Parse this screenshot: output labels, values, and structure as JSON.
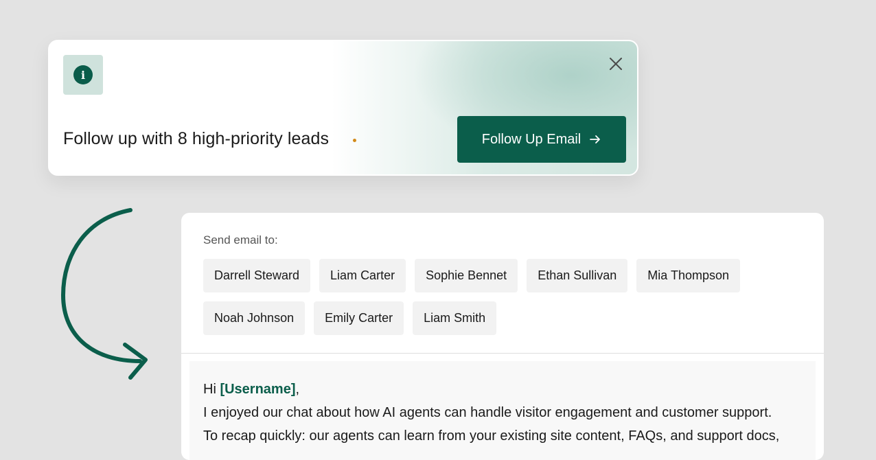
{
  "notification": {
    "message": "Follow up with 8 high-priority leads",
    "button_label": "Follow Up Email",
    "icons": {
      "info": "info-icon",
      "close": "close-icon",
      "button": "arrow-right-icon"
    },
    "info_glyph": "i"
  },
  "email": {
    "send_label": "Send email to:",
    "recipients": [
      "Darrell Steward",
      "Liam Carter",
      "Sophie Bennet",
      "Ethan Sullivan",
      "Mia Thompson",
      "Noah Johnson",
      "Emily Carter",
      "Liam Smith"
    ],
    "greeting_prefix": "Hi ",
    "username_placeholder": "[Username]",
    "greeting_suffix": ",",
    "lines": [
      "I enjoyed our chat about how AI agents can handle visitor engagement and customer support.",
      "To recap quickly: our agents can learn from your existing site content, FAQs, and support docs,"
    ]
  },
  "colors": {
    "brand": "#0b5e4b",
    "accent_dot": "#d28a1a",
    "background": "#e3e3e3",
    "chip": "#f2f2f2"
  }
}
